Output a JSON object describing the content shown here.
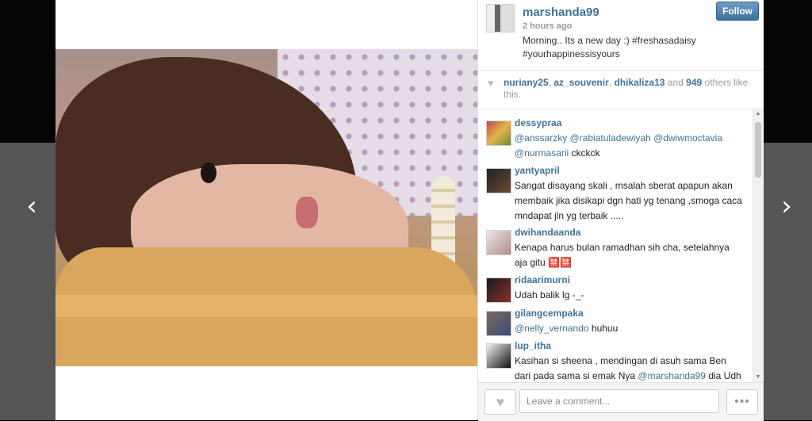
{
  "navigation": {
    "prev_glyph": "‹",
    "next_glyph": "›"
  },
  "post": {
    "username": "marshanda99",
    "time": "2 hours ago",
    "caption_line1": "Morning.. Its a new day :) #freshasadaisy",
    "caption_line2": "#yourhappinessisyours",
    "follow_label": "Follow"
  },
  "likes": {
    "user1": "nuriany25",
    "user2": "az_souvenir",
    "user3": "dhikaliza13",
    "and": "and",
    "count": "949",
    "suffix": "others like this."
  },
  "comments": [
    {
      "username": "dessypraa",
      "line1_mentions": "@anssarzky @rabiatuladewiyah @dwiwmoctavia",
      "line2_mention": "@nurmasarii",
      "line2_rest": " ckckck"
    },
    {
      "username": "yantyapril",
      "text": "Sangat disayang skali , msalah sberat apapun akan membaik jika disikapi dgn hati yg tenang ,smoga caca mndapat jln yg terbaik ....."
    },
    {
      "username": "dwihandaanda",
      "text": "Kenapa harus bulan ramadhan sih cha, setelahnya aja gitu 🈲🈲"
    },
    {
      "username": "ridaarimurni",
      "text": "Udah balik lg -_-"
    },
    {
      "username": "gilangcempaka",
      "mention": "@nelly_vernando",
      "rest": " huhuu"
    },
    {
      "username": "lup_itha",
      "text_pre": "Kasihan si sheena , mendingan di asuh sama Ben dari pada sama si emak Nya ",
      "mention": "@marshanda99",
      "text_post": " dia Udh stress depresi lagi kaya waldy itu video ohlum"
    }
  ],
  "footer": {
    "comment_placeholder": "Leave a comment...",
    "like_icon": "heart-icon",
    "more_icon": "more-dots-icon",
    "more_glyph": "•••",
    "heart_glyph": "♥"
  },
  "colors": {
    "link": "#3f729b",
    "follow_button": "#3f729b",
    "muted": "#999999"
  }
}
